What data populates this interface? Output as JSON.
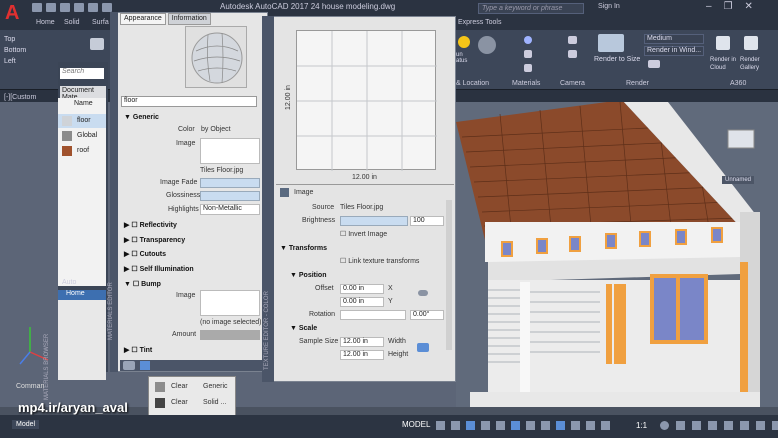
{
  "title_bar": {
    "window_title": "Autodesk AutoCAD 2017   24 house modeling.dwg",
    "search_placeholder": "Type a keyword or phrase",
    "sign_in": "Sign In",
    "app_letter": "A"
  },
  "ribbon_tabs": [
    "Home",
    "Solid",
    "Surfa",
    "Express Tools"
  ],
  "ribbon": {
    "views": [
      "Top",
      "Bottom",
      "Left"
    ],
    "render_preset": "Medium",
    "render_target": "Render in Wind...",
    "render_to_size": "Render to Size",
    "render_in_cloud": "Render in Cloud",
    "render_gallery": "Render Gallery",
    "panel_titles": [
      "& Location",
      "Materials",
      "Camera",
      "Render",
      "A360"
    ],
    "sun_label": "un atus"
  },
  "viewport": {
    "label": "[-][Custom",
    "unnamed": "Unnamed"
  },
  "materials_browser": {
    "search_placeholder": "Search",
    "document_materials": "Document Mate",
    "column_name": "Name",
    "items": [
      {
        "name": "floor",
        "color": "#cfd3d8"
      },
      {
        "name": "Global",
        "color": "#8c8c8c"
      },
      {
        "name": "roof",
        "color": "#a0522d"
      }
    ],
    "auto": "Auto",
    "home": "Home",
    "vertical_label": "MATERIALS BROWSER"
  },
  "material_editor": {
    "tabs": [
      "Appearance",
      "Information"
    ],
    "material_name": "floor",
    "generic_section": "Generic",
    "color_label": "Color",
    "color_value": "by Object",
    "image_label": "Image",
    "image_file": "Tiles Floor.jpg",
    "image_fade_label": "Image Fade",
    "glossiness_label": "Glossiness",
    "highlights_label": "Highlights",
    "highlights_value": "Non-Metallic",
    "sections": [
      "Reflectivity",
      "Transparency",
      "Cutouts",
      "Self Illumination"
    ],
    "bump_section": "Bump",
    "bump_image_label": "Image",
    "bump_none": "(no image selected)",
    "amount_label": "Amount",
    "tint_section": "Tint",
    "vertical_label": "MATERIALS EDITOR"
  },
  "texture_editor": {
    "size_label_x": "12.00 in",
    "size_label_y": "12.00 in",
    "image_section": "Image",
    "source_label": "Source",
    "source_value": "Tiles Floor.jpg",
    "brightness_label": "Brightness",
    "brightness_value": "100",
    "invert_label": "Invert Image",
    "transforms_section": "Transforms",
    "link_label": "Link texture transforms",
    "position_section": "Position",
    "offset_label": "Offset",
    "offset_x": "0.00 in",
    "offset_y": "0.00 in",
    "x_label": "X",
    "y_label": "Y",
    "rotation_label": "Rotation",
    "rotation_value": "0.00°",
    "scale_section": "Scale",
    "sample_size_label": "Sample Size",
    "width_value": "12.00 in",
    "height_value": "12.00 in",
    "width_label": "Width",
    "height_label": "Height",
    "vertical_label": "TEXTURE EDITOR - COLOR"
  },
  "popup": {
    "rows": [
      [
        "Clear",
        "Generic"
      ],
      [
        "Clear",
        "Solid ..."
      ]
    ]
  },
  "status_bar": {
    "model": "MODEL",
    "scale": "1:1",
    "command": "Comman",
    "model_tab": "Model"
  },
  "watermark": "mp4.ir/aryan_aval",
  "colors": {
    "roof": "#8b4a2b",
    "wall": "#f2f2f2",
    "accent_orange": "#f0a040",
    "window_blue": "#7a86c8"
  }
}
